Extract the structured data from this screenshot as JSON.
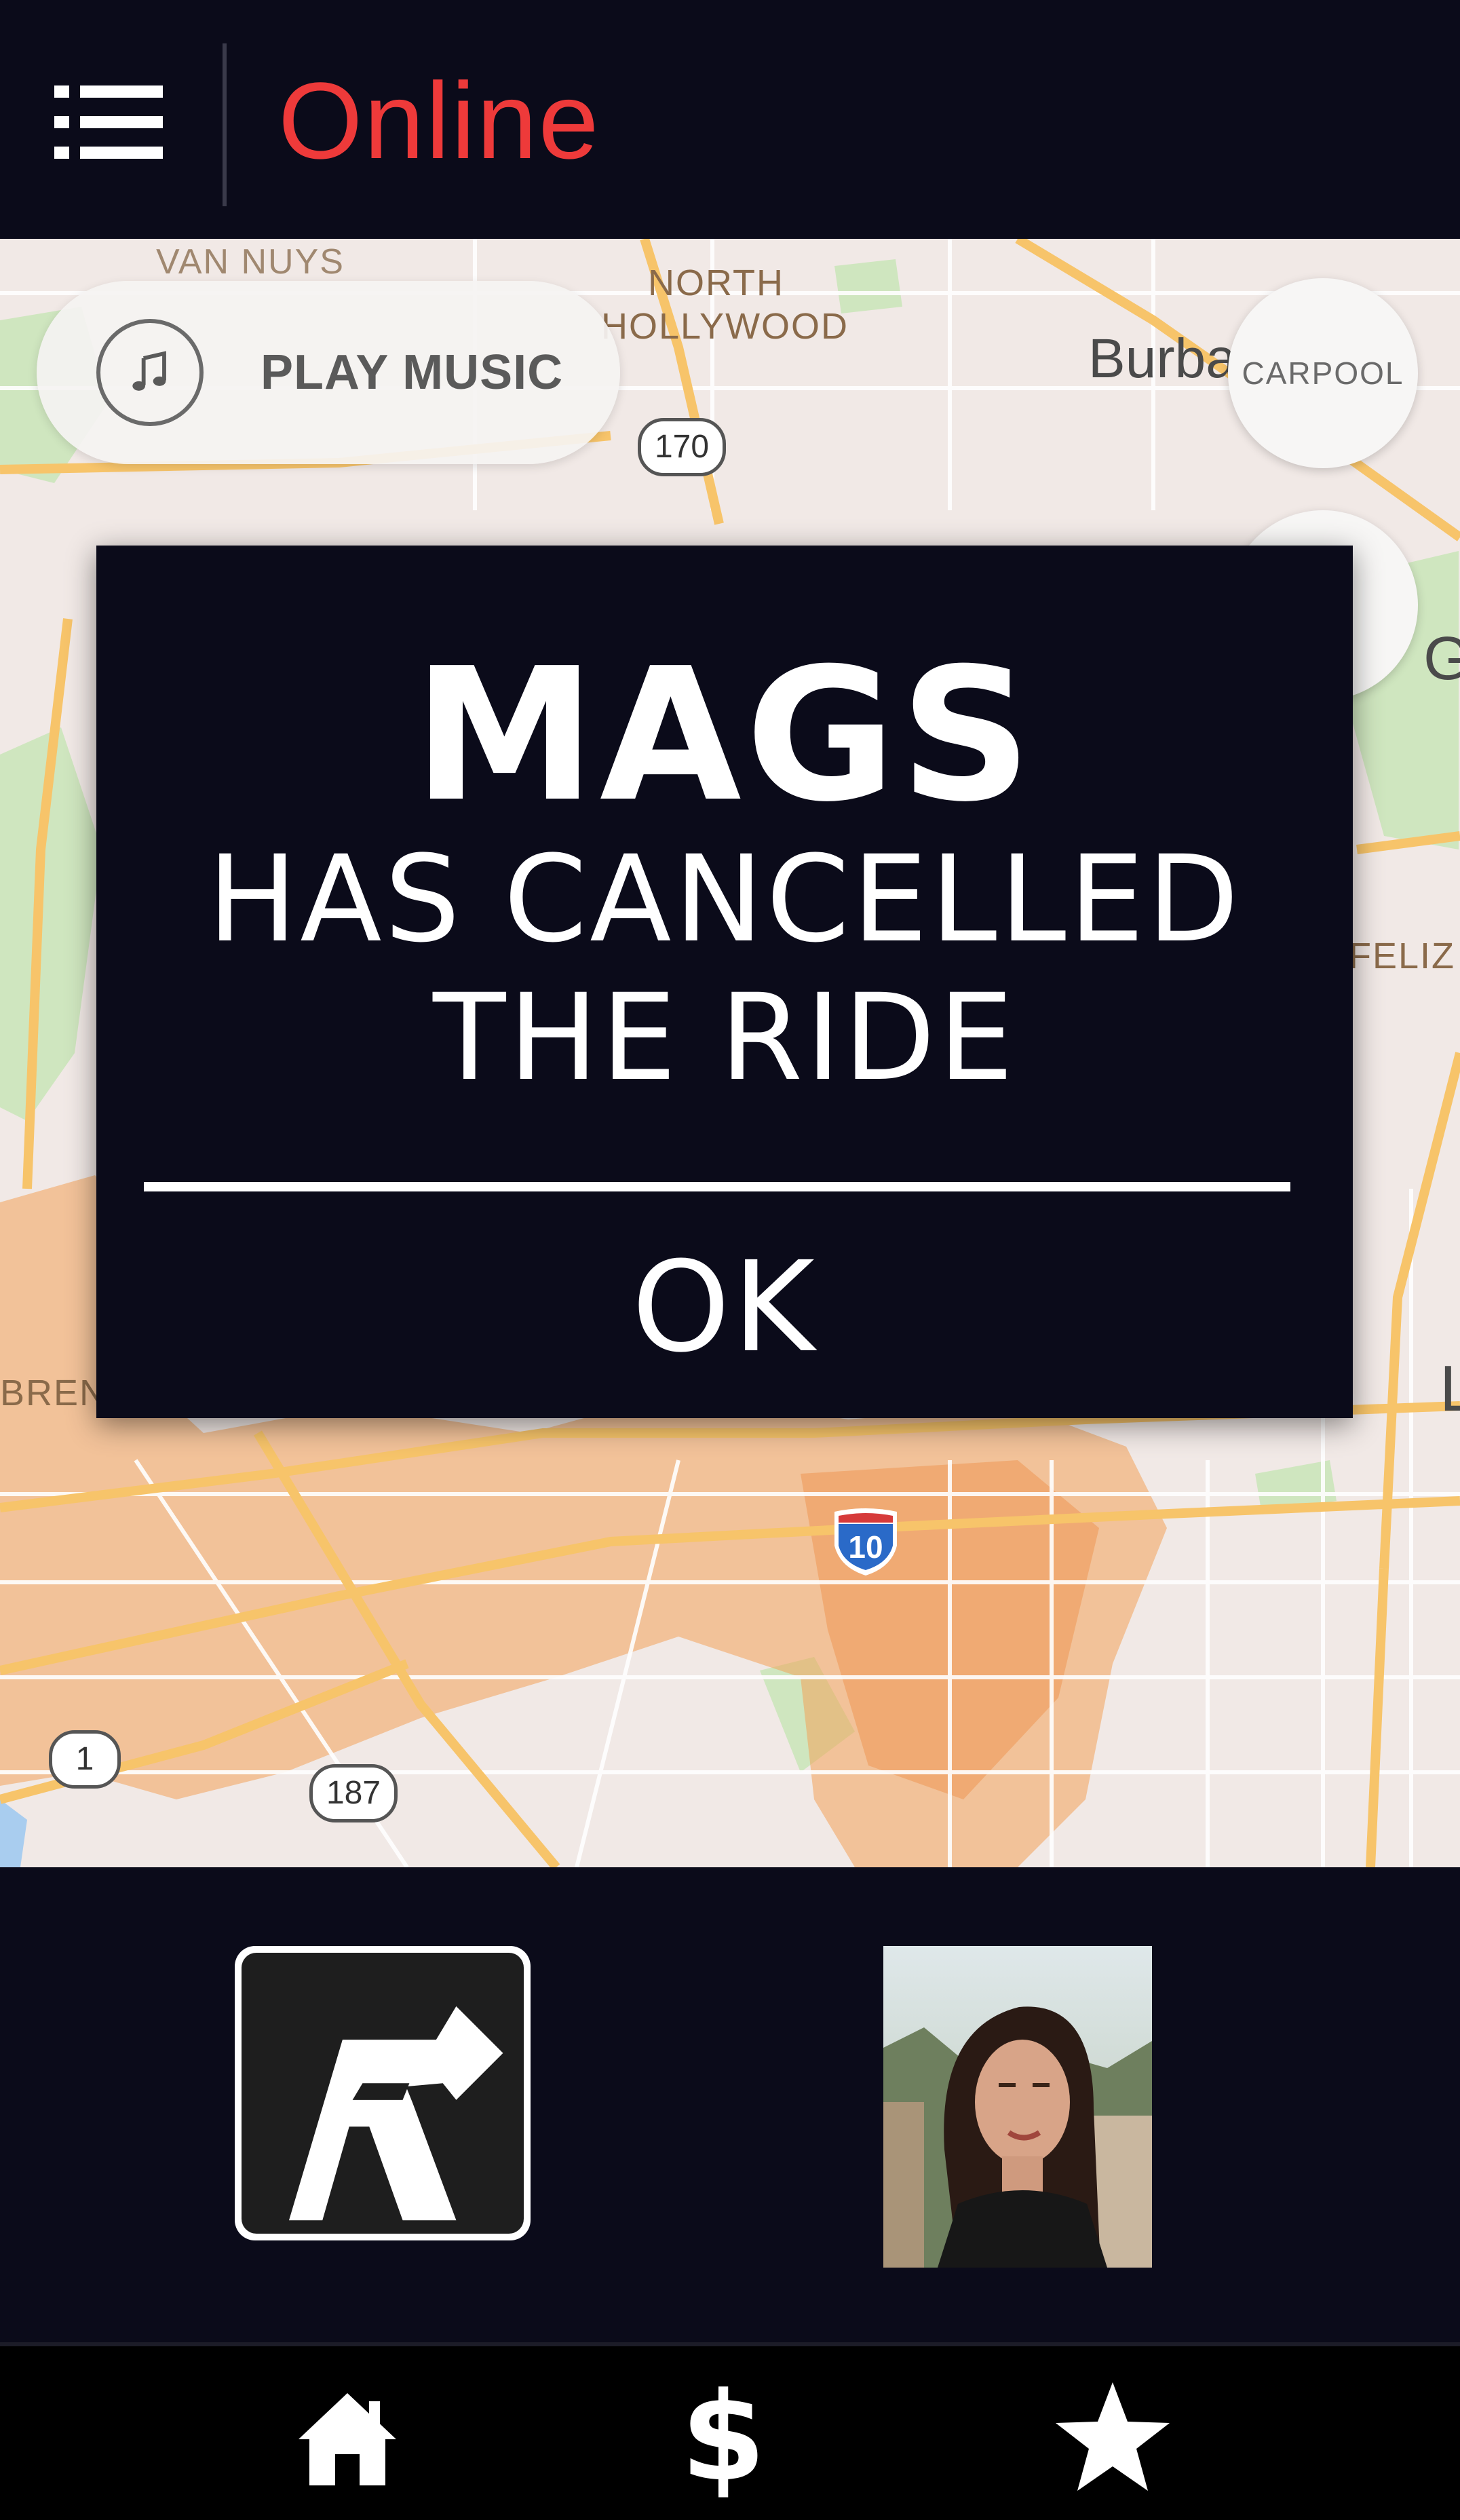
{
  "header": {
    "status_title": "Online",
    "menu_icon": "list-menu-icon"
  },
  "map": {
    "places": {
      "van_nuys": "VAN NUYS",
      "north_hollywood_1": "NORTH",
      "north_hollywood_2": "HOLLYWOOD",
      "burbank": "Burba",
      "feliz": "FELIZ",
      "brentwood": "BRENT",
      "glendale": "G",
      "los_angeles": "L"
    },
    "highways": {
      "hwy_170": "170",
      "hwy_1": "1",
      "hwy_187": "187",
      "interstate_10": "10"
    },
    "play_music_label": "PLAY MUSIC",
    "music_icon": "music-note-icon",
    "carpool_label": "CARPOOL",
    "colors": {
      "land": "#f1e9e6",
      "road_major": "#f7c46a",
      "road_minor": "#ffffff",
      "park": "#cfe6bf",
      "water": "#a9cdef",
      "surge": "#f2a35a"
    }
  },
  "modal": {
    "rider_name": "MAGS",
    "message_line1": "HAS CANCELLED",
    "message_line2": "THE RIDE",
    "ok_label": "OK"
  },
  "panel": {
    "brand_logo": "r-brand-logo",
    "avatar": "rider-avatar-photo"
  },
  "bottom_nav": {
    "home_icon": "home-icon",
    "earnings_label": "$",
    "earnings_icon": "dollar-icon",
    "rating_icon": "star-icon"
  },
  "colors": {
    "app_bg": "#0b0b1a",
    "accent_red": "#ee3a3a",
    "text_white": "#ffffff"
  }
}
